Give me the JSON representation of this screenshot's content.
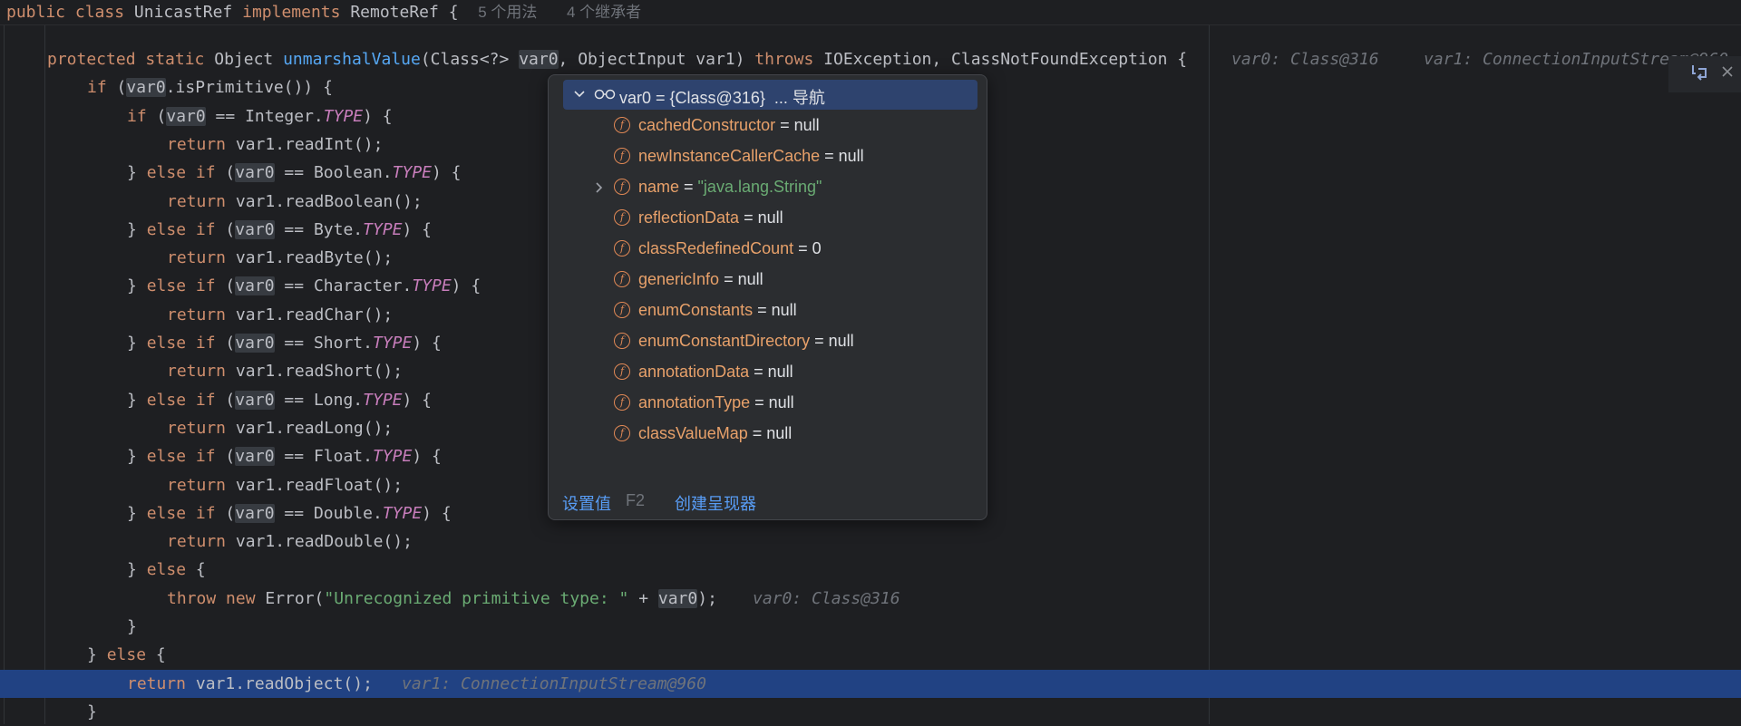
{
  "header": {
    "code_prefix": "public class ",
    "class_name": "UnicastRef",
    "implements_kw": "implements",
    "interface_name": "RemoteRef {",
    "usages": "5 个用法",
    "inheritors": "4 个继承者"
  },
  "inline_hints": {
    "method_line_var0": "var0: Class@316",
    "method_line_var1": "var1: ConnectionInputStream@960",
    "throw_line_var0": "var0: Class@316",
    "return_line_var1": "var1: ConnectionInputStream@960"
  },
  "code_lines": [
    {
      "segments": [
        [
          "kw",
          "protected static "
        ],
        [
          "",
          "Object "
        ],
        [
          "fn",
          "unmarshalValue"
        ],
        [
          "",
          "(Class<?> "
        ],
        [
          "hl",
          "var0"
        ],
        [
          "",
          ", ObjectInput var1) "
        ],
        [
          "kw",
          "throws "
        ],
        [
          "",
          "IOException, ClassNotFoundException {"
        ]
      ]
    },
    {
      "segments": [
        [
          "kw",
          "if "
        ],
        [
          "",
          "("
        ],
        [
          "hl",
          "var0"
        ],
        [
          "",
          ".isPrimitive()) {"
        ]
      ]
    },
    {
      "segments": [
        [
          "kw",
          "if "
        ],
        [
          "",
          "("
        ],
        [
          "hl",
          "var0"
        ],
        [
          "",
          " == Integer."
        ],
        [
          "cst",
          "TYPE"
        ],
        [
          "",
          ") {"
        ]
      ]
    },
    {
      "segments": [
        [
          "kw",
          "return "
        ],
        [
          "",
          "var1.readInt();"
        ]
      ]
    },
    {
      "segments": [
        [
          "",
          "} "
        ],
        [
          "kw",
          "else if "
        ],
        [
          "",
          "("
        ],
        [
          "hl",
          "var0"
        ],
        [
          "",
          " == Boolean."
        ],
        [
          "cst",
          "TYPE"
        ],
        [
          "",
          ") {"
        ]
      ]
    },
    {
      "segments": [
        [
          "kw",
          "return "
        ],
        [
          "",
          "var1.readBoolean();"
        ]
      ]
    },
    {
      "segments": [
        [
          "",
          "} "
        ],
        [
          "kw",
          "else if "
        ],
        [
          "",
          "("
        ],
        [
          "hl",
          "var0"
        ],
        [
          "",
          " == Byte."
        ],
        [
          "cst",
          "TYPE"
        ],
        [
          "",
          ") {"
        ]
      ]
    },
    {
      "segments": [
        [
          "kw",
          "return "
        ],
        [
          "",
          "var1.readByte();"
        ]
      ]
    },
    {
      "segments": [
        [
          "",
          "} "
        ],
        [
          "kw",
          "else if "
        ],
        [
          "",
          "("
        ],
        [
          "hl",
          "var0"
        ],
        [
          "",
          " == Character."
        ],
        [
          "cst",
          "TYPE"
        ],
        [
          "",
          ") {"
        ]
      ]
    },
    {
      "segments": [
        [
          "kw",
          "return "
        ],
        [
          "",
          "var1.readChar();"
        ]
      ]
    },
    {
      "segments": [
        [
          "",
          "} "
        ],
        [
          "kw",
          "else if "
        ],
        [
          "",
          "("
        ],
        [
          "hl",
          "var0"
        ],
        [
          "",
          " == Short."
        ],
        [
          "cst",
          "TYPE"
        ],
        [
          "",
          ") {"
        ]
      ]
    },
    {
      "segments": [
        [
          "kw",
          "return "
        ],
        [
          "",
          "var1.readShort();"
        ]
      ]
    },
    {
      "segments": [
        [
          "",
          "} "
        ],
        [
          "kw",
          "else if "
        ],
        [
          "",
          "("
        ],
        [
          "hl",
          "var0"
        ],
        [
          "",
          " == Long."
        ],
        [
          "cst",
          "TYPE"
        ],
        [
          "",
          ") {"
        ]
      ]
    },
    {
      "segments": [
        [
          "kw",
          "return "
        ],
        [
          "",
          "var1.readLong();"
        ]
      ]
    },
    {
      "segments": [
        [
          "",
          "} "
        ],
        [
          "kw",
          "else if "
        ],
        [
          "",
          "("
        ],
        [
          "hl",
          "var0"
        ],
        [
          "",
          " == Float."
        ],
        [
          "cst",
          "TYPE"
        ],
        [
          "",
          ") {"
        ]
      ]
    },
    {
      "segments": [
        [
          "kw",
          "return "
        ],
        [
          "",
          "var1.readFloat();"
        ]
      ]
    },
    {
      "segments": [
        [
          "",
          "} "
        ],
        [
          "kw",
          "else if "
        ],
        [
          "",
          "("
        ],
        [
          "hl",
          "var0"
        ],
        [
          "",
          " == Double."
        ],
        [
          "cst",
          "TYPE"
        ],
        [
          "",
          ") {"
        ]
      ]
    },
    {
      "segments": [
        [
          "kw",
          "return "
        ],
        [
          "",
          "var1.readDouble();"
        ]
      ]
    },
    {
      "segments": [
        [
          "",
          "} "
        ],
        [
          "kw",
          "else "
        ],
        [
          "",
          "{"
        ]
      ]
    },
    {
      "segments": [
        [
          "kw",
          "throw new "
        ],
        [
          "",
          "Error("
        ],
        [
          "str",
          "\"Unrecognized primitive type: \""
        ],
        [
          "",
          " + "
        ],
        [
          "hl",
          "var0"
        ],
        [
          "",
          ");"
        ]
      ]
    },
    {
      "segments": [
        [
          "",
          "}"
        ]
      ]
    },
    {
      "segments": [
        [
          "",
          "} "
        ],
        [
          "kw",
          "else "
        ],
        [
          "",
          "{"
        ]
      ]
    },
    {
      "segments": [
        [
          "kw",
          "return "
        ],
        [
          "",
          "var1.readObject();"
        ]
      ]
    },
    {
      "segments": [
        [
          "",
          "}"
        ]
      ]
    }
  ],
  "popup": {
    "root_label": "var0 = {Class@316}",
    "root_nav": "... 导航",
    "fields": [
      {
        "name": "cachedConstructor",
        "eq": " = ",
        "value": "null",
        "is_string": false,
        "expandable": false
      },
      {
        "name": "newInstanceCallerCache",
        "eq": " = ",
        "value": "null",
        "is_string": false,
        "expandable": false
      },
      {
        "name": "name",
        "eq": " = ",
        "value": "\"java.lang.String\"",
        "is_string": true,
        "expandable": true
      },
      {
        "name": "reflectionData",
        "eq": " = ",
        "value": "null",
        "is_string": false,
        "expandable": false
      },
      {
        "name": "classRedefinedCount",
        "eq": " = ",
        "value": "0",
        "is_string": false,
        "expandable": false
      },
      {
        "name": "genericInfo",
        "eq": " = ",
        "value": "null",
        "is_string": false,
        "expandable": false
      },
      {
        "name": "enumConstants",
        "eq": " = ",
        "value": "null",
        "is_string": false,
        "expandable": false
      },
      {
        "name": "enumConstantDirectory",
        "eq": " = ",
        "value": "null",
        "is_string": false,
        "expandable": false
      },
      {
        "name": "annotationData",
        "eq": " = ",
        "value": "null",
        "is_string": false,
        "expandable": false
      },
      {
        "name": "annotationType",
        "eq": " = ",
        "value": "null",
        "is_string": false,
        "expandable": false
      },
      {
        "name": "classValueMap",
        "eq": " = ",
        "value": "null",
        "is_string": false,
        "expandable": false
      }
    ],
    "field_icon_letter": "f",
    "footer": {
      "set_value": "设置值",
      "set_value_key": "F2",
      "create_renderer": "创建呈现器"
    }
  },
  "colors": {
    "background": "#1e1f22",
    "keyword": "#cf8e6d",
    "function": "#56a8f5",
    "constant": "#c77dbb",
    "string": "#6aab73",
    "current_line": "#214283",
    "popup_selected": "#2e436e",
    "field_name": "#e8a16a",
    "link": "#589df6"
  },
  "current_line_index": 22,
  "icons": [
    "chevron-down-icon",
    "glasses-icon",
    "field-icon",
    "chevron-right-icon",
    "reload-icon",
    "close-icon"
  ]
}
